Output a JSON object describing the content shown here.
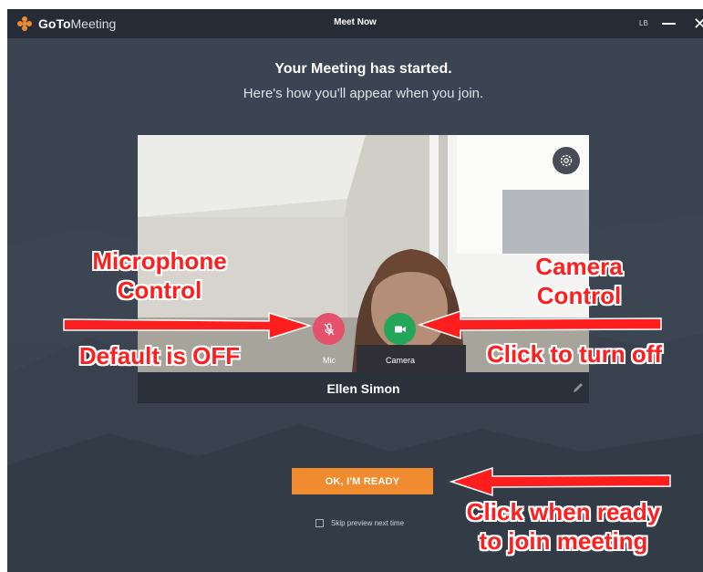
{
  "window": {
    "app_name_part1": "GoTo",
    "app_name_part2": "Meeting",
    "title": "Meet Now",
    "user_initials": "LB",
    "minimize_icon": "minimize-icon",
    "close_icon": "close-icon",
    "close_glyph": "✕"
  },
  "main": {
    "headline": "Your Meeting has started.",
    "subline": "Here's how you'll appear when you join."
  },
  "preview": {
    "settings_icon": "gear-icon",
    "mic_label": "Mic",
    "mic_state": "off",
    "camera_label": "Camera",
    "camera_state": "on",
    "participant_name": "Ellen Simon",
    "edit_icon": "pencil-icon"
  },
  "actions": {
    "ready_button": "OK, I'M READY",
    "skip_label": "Skip preview next time",
    "skip_checked": false
  },
  "annotations": {
    "mic_title_line1": "Microphone",
    "mic_title_line2": "Control",
    "mic_default": "Default is OFF",
    "camera_title_line1": "Camera",
    "camera_title_line2": "Control",
    "camera_click": "Click to turn off",
    "ready_line1": "Click when ready",
    "ready_line2": "to join meeting",
    "color": "#ff1e1e"
  },
  "colors": {
    "titlebar": "#252c36",
    "background": "#3a4350",
    "mic_off": "#e5506a",
    "camera_on": "#23a55a",
    "ready_button": "#f18b2f"
  }
}
